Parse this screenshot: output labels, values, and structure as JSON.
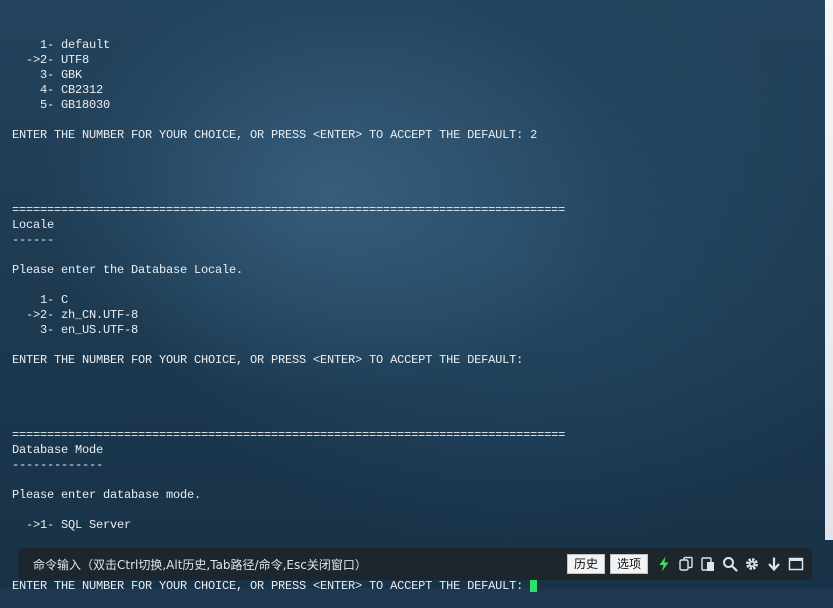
{
  "terminal": {
    "lines": [
      "    1- default",
      "  ->2- UTF8",
      "    3- GBK",
      "    4- CB2312",
      "    5- GB18030",
      "",
      "ENTER THE NUMBER FOR YOUR CHOICE, OR PRESS <ENTER> TO ACCEPT THE DEFAULT: 2",
      "",
      "",
      "",
      "",
      "===============================================================================",
      "Locale",
      "------",
      "",
      "Please enter the Database Locale.",
      "",
      "    1- C",
      "  ->2- zh_CN.UTF-8",
      "    3- en_US.UTF-8",
      "",
      "ENTER THE NUMBER FOR YOUR CHOICE, OR PRESS <ENTER> TO ACCEPT THE DEFAULT:",
      "",
      "",
      "",
      "",
      "===============================================================================",
      "Database Mode",
      "-------------",
      "",
      "Please enter database mode.",
      "",
      "  ->1- SQL Server",
      ""
    ],
    "prompt": "ENTER THE NUMBER FOR YOUR CHOICE, OR PRESS <ENTER> TO ACCEPT THE DEFAULT:",
    "cursor_color": "#2fe06b"
  },
  "command_bar": {
    "hint": "命令输入（双击Ctrl切换,Alt历史,Tab路径/命令,Esc关闭窗口）",
    "history_label": "历史",
    "options_label": "选项",
    "icons": [
      "lightning-icon",
      "copy-icon",
      "paste-icon",
      "search-icon",
      "gear-icon",
      "download-icon",
      "window-icon"
    ],
    "lightning_color": "#3ddc59"
  }
}
